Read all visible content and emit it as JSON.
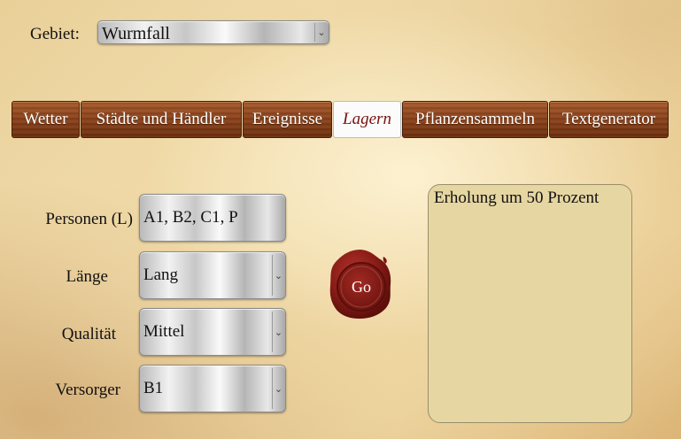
{
  "gebiet": {
    "label": "Gebiet:",
    "value": "Wurmfall"
  },
  "tabs": [
    {
      "label": "Wetter",
      "active": false
    },
    {
      "label": "Städte und Händler",
      "active": false
    },
    {
      "label": "Ereignisse",
      "active": false
    },
    {
      "label": "Lagern",
      "active": true
    },
    {
      "label": "Pflanzensammeln",
      "active": false
    },
    {
      "label": "Textgenerator",
      "active": false
    }
  ],
  "form": {
    "personen": {
      "label": "Personen (L)",
      "value": "A1, B2, C1, P"
    },
    "laenge": {
      "label": "Länge",
      "value": "Lang"
    },
    "qualitaet": {
      "label": "Qualität",
      "value": "Mittel"
    },
    "versorger": {
      "label": "Versorger",
      "value": "B1"
    }
  },
  "go_button": {
    "label": "Go"
  },
  "output": {
    "text": "Erholung um 50 Prozent"
  },
  "colors": {
    "tab_wood": "#8a4119",
    "active_tab_text": "#7a1010",
    "seal": "#8e1f1a",
    "output_bg": "#e6d6a2"
  }
}
